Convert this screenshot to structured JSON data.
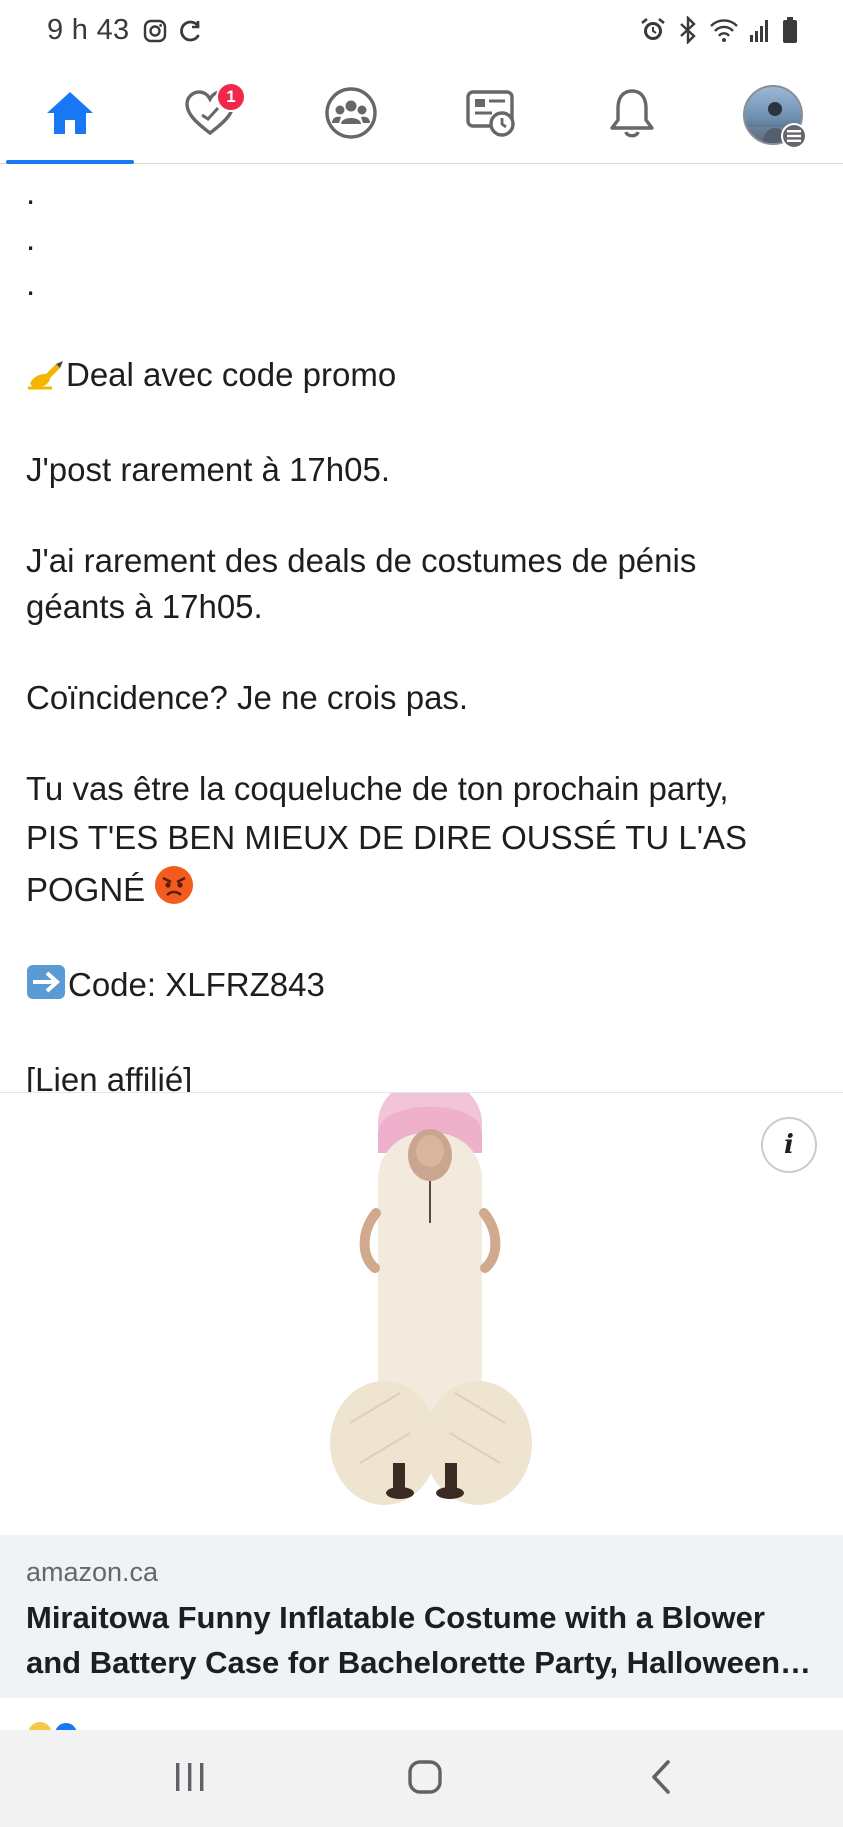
{
  "status_bar": {
    "time": "9 h 43",
    "left_icons": [
      "instagram-icon",
      "sync-icon"
    ],
    "right_icons": [
      "alarm-icon",
      "bluetooth-icon",
      "wifi-icon",
      "signal-icon",
      "battery-icon"
    ]
  },
  "nav": {
    "items": [
      {
        "name": "home",
        "icon": "home-icon",
        "active": true
      },
      {
        "name": "dating",
        "icon": "heart-icon",
        "badge": "1"
      },
      {
        "name": "groups",
        "icon": "groups-icon"
      },
      {
        "name": "watch",
        "icon": "memories-icon"
      },
      {
        "name": "notifications",
        "icon": "bell-icon"
      },
      {
        "name": "menu",
        "icon": "avatar"
      }
    ],
    "active_color": "#1877f2",
    "badge_color": "#f02849"
  },
  "post": {
    "dots": [
      ".",
      ".",
      "."
    ],
    "line_deal": "Deal avec code promo",
    "line_post": "J'post rarement à 17h05.",
    "line_deals_1": "J'ai rarement des deals de costumes de pénis",
    "line_deals_2": "géants à 17h05.",
    "line_coincidence": "Coïncidence? Je ne crois pas.",
    "line_party_1": "Tu vas être la coqueluche de ton prochain party,",
    "line_party_2": "PIS T'ES BEN MIEUX DE DIRE OUSSÉ TU L'AS",
    "line_party_3": "POGNÉ",
    "line_code": "Code: XLFRZ843",
    "line_link": "[Lien affilié]",
    "emoji_deal": "writing-hand-icon",
    "emoji_angry": "angry-face-icon",
    "emoji_arrow": "right-arrow-icon"
  },
  "link_card": {
    "image": "inflatable-costume-image",
    "info_label": "i",
    "domain": "amazon.ca",
    "title": "Miraitowa Funny Inflatable Costume with a Blower and Battery Case for Bachelorette Party, Halloween Costume"
  },
  "android_nav": {
    "buttons": [
      "recents-icon",
      "home-button-icon",
      "back-icon"
    ]
  }
}
